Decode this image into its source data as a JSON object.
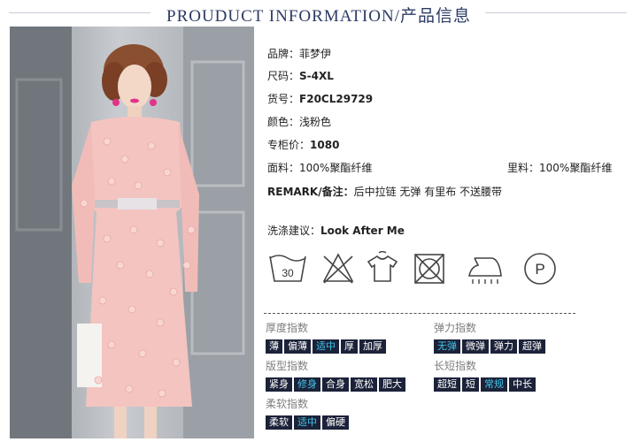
{
  "header": {
    "title": "PROUDUCT INFORMATION/产品信息"
  },
  "product": {
    "brand_label": "品牌：",
    "brand": "菲梦伊",
    "size_label": "尺码：",
    "size": "S-4XL",
    "code_label": "货号：",
    "code": "F20CL29729",
    "color_label": "颜色：",
    "color": "浅粉色",
    "price_label": "专柜价：",
    "price": "1080",
    "fabric_label": "面料：",
    "fabric": "100%聚酯纤维",
    "lining_label": "里料：",
    "lining": "100%聚酯纤维",
    "remark_label": "REMARK/备注：",
    "remark": "后中拉链 无弹 有里布 不送腰带",
    "wash_label": "洗涤建议：",
    "wash": "Look After Me"
  },
  "care_icons": [
    {
      "name": "wash-30-icon",
      "text": "30"
    },
    {
      "name": "no-bleach-icon"
    },
    {
      "name": "hang-dry-icon"
    },
    {
      "name": "no-tumble-dry-icon"
    },
    {
      "name": "iron-low-icon"
    },
    {
      "name": "dry-clean-p-icon",
      "text": "P"
    }
  ],
  "groups": {
    "thickness": {
      "title": "厚度指数",
      "options": [
        "薄",
        "偏薄",
        "适中",
        "厚",
        "加厚"
      ],
      "selected": "适中"
    },
    "elasticity": {
      "title": "弹力指数",
      "options": [
        "无弹",
        "微弹",
        "弹力",
        "超弹"
      ],
      "selected": "无弹"
    },
    "fit": {
      "title": "版型指数",
      "options": [
        "紧身",
        "修身",
        "合身",
        "宽松",
        "肥大"
      ],
      "selected": "修身"
    },
    "length": {
      "title": "长短指数",
      "options": [
        "超短",
        "短",
        "常规",
        "中长"
      ],
      "selected": "常规"
    },
    "softness": {
      "title": "柔软指数",
      "options": [
        "柔软",
        "适中",
        "偏硬"
      ],
      "selected": "适中"
    }
  },
  "colors": {
    "title": "#2c3a64",
    "chip_bg": "#1b2239",
    "chip_on": "#42c6ea",
    "dress": "#f4c4c0"
  }
}
